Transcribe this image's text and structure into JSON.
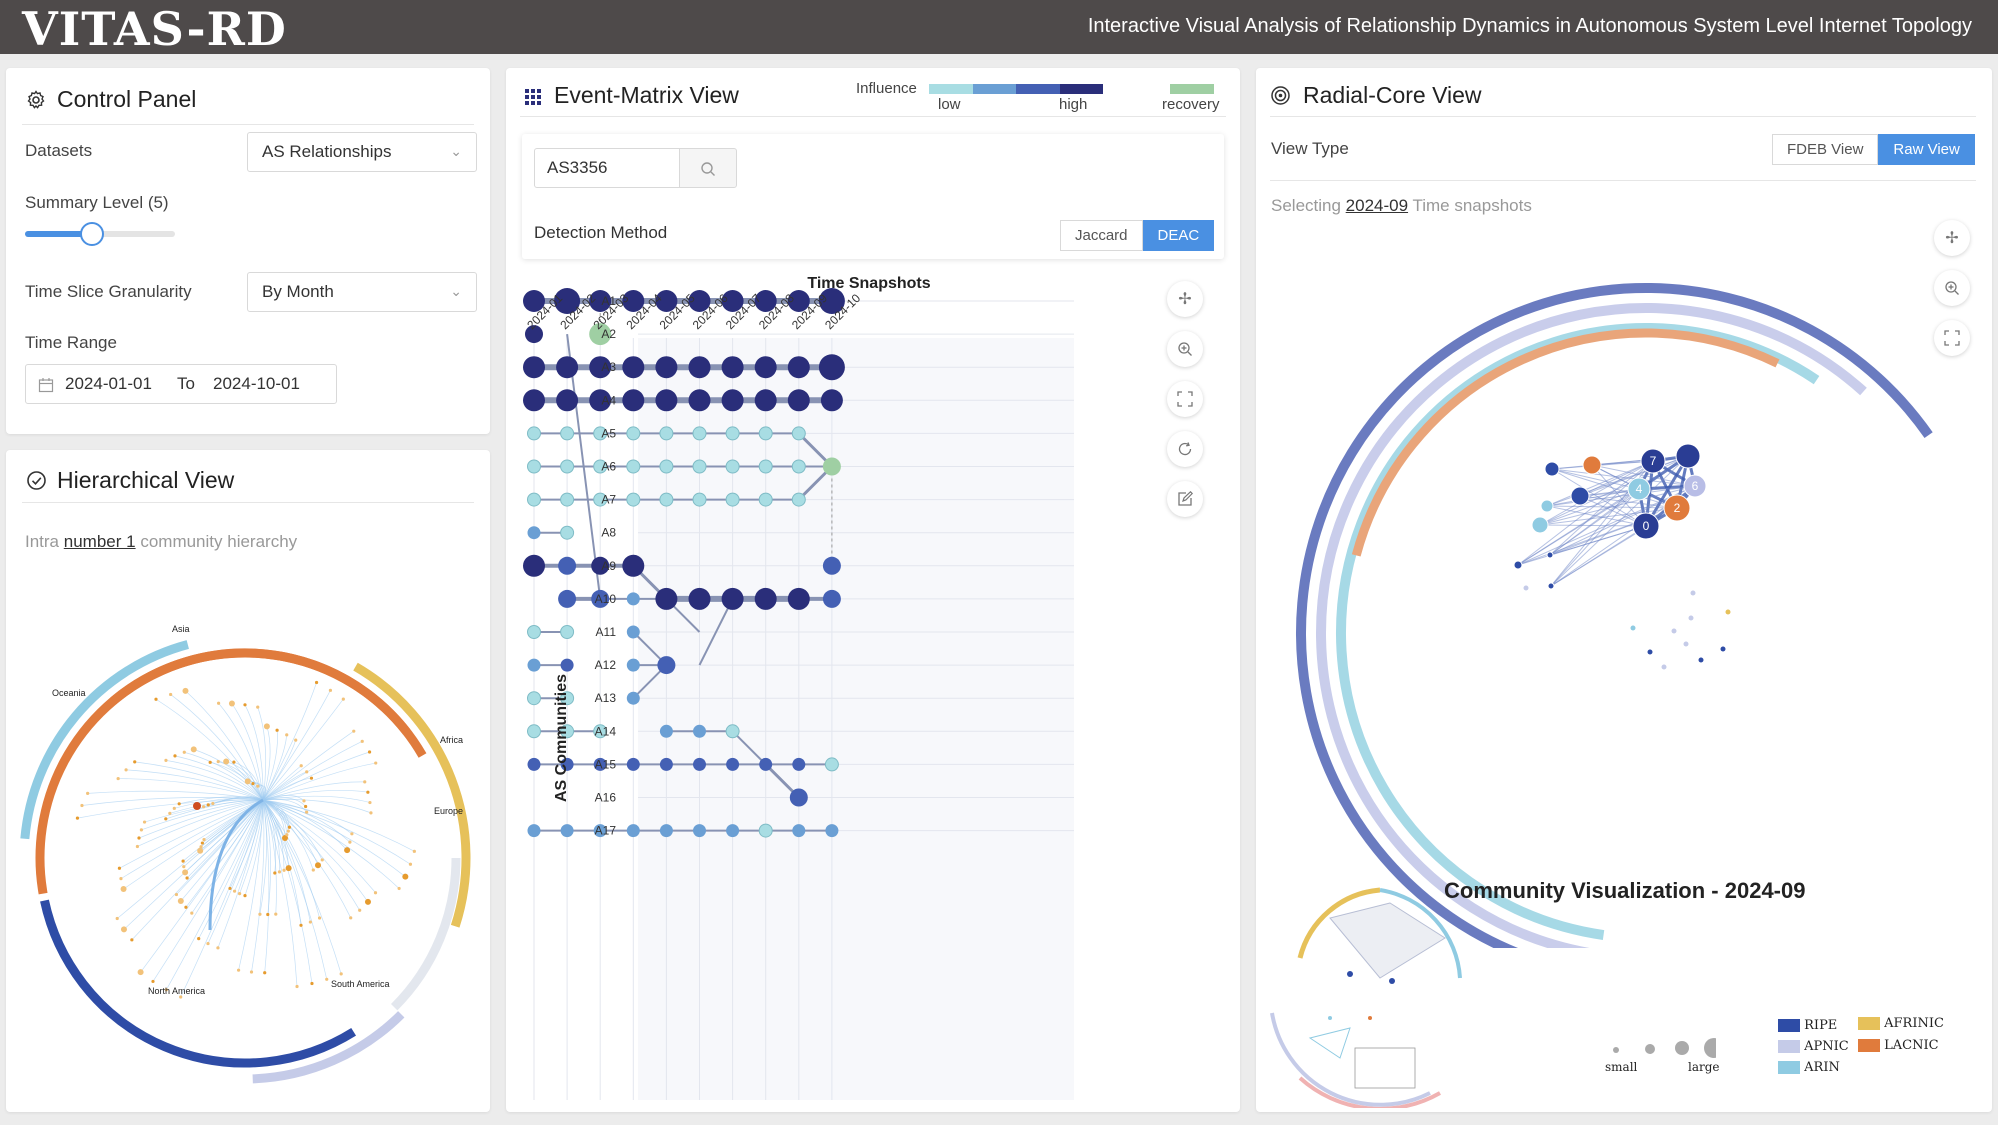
{
  "app": {
    "logo": "VITAS-RD",
    "subtitle": "Interactive Visual Analysis of Relationship Dynamics in Autonomous System Level Internet Topology"
  },
  "control_panel": {
    "title": "Control Panel",
    "datasets_label": "Datasets",
    "datasets_value": "AS Relationships",
    "summary_label": "Summary Level (5)",
    "summary_level": 5,
    "granularity_label": "Time Slice Granularity",
    "granularity_value": "By Month",
    "time_range_label": "Time Range",
    "time_from": "2024-01-01",
    "time_to_label": "To",
    "time_to": "2024-10-01"
  },
  "hierarchical": {
    "title": "Hierarchical View",
    "intra_prefix": "Intra",
    "intra_link": "number 1",
    "intra_suffix": "community hierarchy",
    "regions": [
      "Asia",
      "Oceania",
      "Africa",
      "Europe",
      "North America",
      "South America"
    ]
  },
  "event_matrix": {
    "title": "Event-Matrix View",
    "legend_influence": "Influence",
    "legend_low": "low",
    "legend_high": "high",
    "legend_recovery": "recovery",
    "search_value": "AS3356",
    "detection_label": "Detection Method",
    "method_options": [
      "Jaccard",
      "DEAC"
    ],
    "method_selected": "DEAC",
    "x_title": "Time Snapshots",
    "y_title": "AS Communities"
  },
  "chart_data": {
    "type": "scatter",
    "title": "Time Snapshots",
    "xlabel": "Time Snapshots",
    "ylabel": "AS Communities",
    "x": [
      "2024-01",
      "2024-02",
      "2024-03",
      "2024-04",
      "2024-05",
      "2024-06",
      "2024-07",
      "2024-08",
      "2024-09",
      "2024-10"
    ],
    "y": [
      "A1",
      "A2",
      "A3",
      "A4",
      "A5",
      "A6",
      "A7",
      "A8",
      "A9",
      "A10",
      "A11",
      "A12",
      "A13",
      "A14",
      "A15",
      "A16",
      "A17"
    ],
    "colors": {
      "low": "#a8dde3",
      "mid1": "#6a9fd4",
      "mid2": "#4460b4",
      "high": "#2a2e7a",
      "recovery": "#9fcfa3"
    },
    "points": [
      {
        "row": "A1",
        "cells": [
          [
            "2024-01",
            "high",
            3
          ],
          [
            "2024-02",
            "high",
            4
          ],
          [
            "2024-03",
            "high",
            3
          ],
          [
            "2024-04",
            "high",
            3
          ],
          [
            "2024-05",
            "high",
            3
          ],
          [
            "2024-06",
            "high",
            3
          ],
          [
            "2024-07",
            "high",
            3
          ],
          [
            "2024-08",
            "high",
            3
          ],
          [
            "2024-09",
            "high",
            3
          ],
          [
            "2024-10",
            "high",
            4
          ]
        ]
      },
      {
        "row": "A2",
        "cells": [
          [
            "2024-01",
            "high",
            2
          ],
          [
            "2024-03",
            "recovery",
            3
          ]
        ]
      },
      {
        "row": "A3",
        "cells": [
          [
            "2024-01",
            "high",
            3
          ],
          [
            "2024-02",
            "high",
            3
          ],
          [
            "2024-03",
            "high",
            3
          ],
          [
            "2024-04",
            "high",
            3
          ],
          [
            "2024-05",
            "high",
            3
          ],
          [
            "2024-06",
            "high",
            3
          ],
          [
            "2024-07",
            "high",
            3
          ],
          [
            "2024-08",
            "high",
            3
          ],
          [
            "2024-09",
            "high",
            3
          ],
          [
            "2024-10",
            "high",
            4
          ]
        ]
      },
      {
        "row": "A4",
        "cells": [
          [
            "2024-01",
            "high",
            3
          ],
          [
            "2024-02",
            "high",
            3
          ],
          [
            "2024-03",
            "high",
            3
          ],
          [
            "2024-04",
            "high",
            3
          ],
          [
            "2024-05",
            "high",
            3
          ],
          [
            "2024-06",
            "high",
            3
          ],
          [
            "2024-07",
            "high",
            3
          ],
          [
            "2024-08",
            "high",
            3
          ],
          [
            "2024-09",
            "high",
            3
          ],
          [
            "2024-10",
            "high",
            3
          ]
        ]
      },
      {
        "row": "A5",
        "cells": [
          [
            "2024-01",
            "low",
            1
          ],
          [
            "2024-02",
            "low",
            1
          ],
          [
            "2024-03",
            "low",
            1
          ],
          [
            "2024-04",
            "low",
            1
          ],
          [
            "2024-05",
            "low",
            1
          ],
          [
            "2024-06",
            "low",
            1
          ],
          [
            "2024-07",
            "low",
            1
          ],
          [
            "2024-08",
            "low",
            1
          ],
          [
            "2024-09",
            "low",
            1
          ]
        ]
      },
      {
        "row": "A6",
        "cells": [
          [
            "2024-01",
            "low",
            1
          ],
          [
            "2024-02",
            "low",
            1
          ],
          [
            "2024-03",
            "low",
            1
          ],
          [
            "2024-04",
            "low",
            1
          ],
          [
            "2024-05",
            "low",
            1
          ],
          [
            "2024-06",
            "low",
            1
          ],
          [
            "2024-07",
            "low",
            1
          ],
          [
            "2024-08",
            "low",
            1
          ],
          [
            "2024-09",
            "low",
            1
          ],
          [
            "2024-10",
            "recovery",
            2
          ]
        ]
      },
      {
        "row": "A7",
        "cells": [
          [
            "2024-01",
            "low",
            1
          ],
          [
            "2024-02",
            "low",
            1
          ],
          [
            "2024-03",
            "low",
            1
          ],
          [
            "2024-04",
            "low",
            1
          ],
          [
            "2024-05",
            "low",
            1
          ],
          [
            "2024-06",
            "low",
            1
          ],
          [
            "2024-07",
            "low",
            1
          ],
          [
            "2024-08",
            "low",
            1
          ],
          [
            "2024-09",
            "low",
            1
          ]
        ]
      },
      {
        "row": "A8",
        "cells": [
          [
            "2024-01",
            "mid1",
            1
          ],
          [
            "2024-02",
            "low",
            1
          ]
        ]
      },
      {
        "row": "A9",
        "cells": [
          [
            "2024-01",
            "high",
            3
          ],
          [
            "2024-02",
            "mid2",
            2
          ],
          [
            "2024-03",
            "high",
            2
          ],
          [
            "2024-04",
            "high",
            3
          ],
          [
            "2024-10",
            "mid2",
            2
          ]
        ]
      },
      {
        "row": "A10",
        "cells": [
          [
            "2024-02",
            "mid2",
            2
          ],
          [
            "2024-03",
            "mid2",
            2
          ],
          [
            "2024-04",
            "mid1",
            1
          ],
          [
            "2024-05",
            "high",
            3
          ],
          [
            "2024-06",
            "high",
            3
          ],
          [
            "2024-07",
            "high",
            3
          ],
          [
            "2024-08",
            "high",
            3
          ],
          [
            "2024-09",
            "high",
            3
          ],
          [
            "2024-10",
            "mid2",
            2
          ]
        ]
      },
      {
        "row": "A11",
        "cells": [
          [
            "2024-01",
            "low",
            1
          ],
          [
            "2024-02",
            "low",
            1
          ],
          [
            "2024-04",
            "mid1",
            1
          ]
        ]
      },
      {
        "row": "A12",
        "cells": [
          [
            "2024-01",
            "mid1",
            1
          ],
          [
            "2024-02",
            "mid2",
            1
          ],
          [
            "2024-04",
            "mid1",
            1
          ],
          [
            "2024-05",
            "mid2",
            2
          ]
        ]
      },
      {
        "row": "A13",
        "cells": [
          [
            "2024-01",
            "low",
            1
          ],
          [
            "2024-02",
            "low",
            1
          ],
          [
            "2024-04",
            "mid1",
            1
          ]
        ]
      },
      {
        "row": "A14",
        "cells": [
          [
            "2024-01",
            "low",
            1
          ],
          [
            "2024-02",
            "low",
            1
          ],
          [
            "2024-03",
            "low",
            1
          ],
          [
            "2024-05",
            "mid1",
            1
          ],
          [
            "2024-06",
            "mid1",
            1
          ],
          [
            "2024-07",
            "low",
            1
          ]
        ]
      },
      {
        "row": "A15",
        "cells": [
          [
            "2024-01",
            "mid2",
            1
          ],
          [
            "2024-02",
            "mid2",
            1
          ],
          [
            "2024-03",
            "mid2",
            1
          ],
          [
            "2024-04",
            "mid2",
            1
          ],
          [
            "2024-05",
            "mid2",
            1
          ],
          [
            "2024-06",
            "mid2",
            1
          ],
          [
            "2024-07",
            "mid2",
            1
          ],
          [
            "2024-08",
            "mid2",
            1
          ],
          [
            "2024-09",
            "mid2",
            1
          ],
          [
            "2024-10",
            "low",
            1
          ]
        ]
      },
      {
        "row": "A16",
        "cells": [
          [
            "2024-09",
            "mid2",
            2
          ]
        ]
      },
      {
        "row": "A17",
        "cells": [
          [
            "2024-01",
            "mid1",
            1
          ],
          [
            "2024-02",
            "mid1",
            1
          ],
          [
            "2024-03",
            "mid1",
            1
          ],
          [
            "2024-04",
            "mid1",
            1
          ],
          [
            "2024-05",
            "mid1",
            1
          ],
          [
            "2024-06",
            "mid1",
            1
          ],
          [
            "2024-07",
            "mid1",
            1
          ],
          [
            "2024-08",
            "low",
            1
          ],
          [
            "2024-09",
            "mid1",
            1
          ],
          [
            "2024-10",
            "mid1",
            1
          ]
        ]
      }
    ]
  },
  "radial": {
    "title": "Radial-Core View",
    "view_type_label": "View Type",
    "view_options": [
      "FDEB View",
      "Raw View"
    ],
    "view_selected": "Raw View",
    "selecting_prefix": "Selecting",
    "selecting_link": "2024-09",
    "selecting_suffix": "Time snapshots",
    "node_labels": [
      "7",
      "6",
      "4",
      "2",
      "0"
    ],
    "community_title": "Community Visualization - 2024-09",
    "size_small": "small",
    "size_large": "large",
    "legend": [
      {
        "name": "RIPE",
        "color": "#2e4ca6"
      },
      {
        "name": "AFRINIC",
        "color": "#e6c15a"
      },
      {
        "name": "APNIC",
        "color": "#c5cbe8"
      },
      {
        "name": "LACNIC",
        "color": "#e07b3c"
      },
      {
        "name": "ARIN",
        "color": "#8fcbe2"
      }
    ]
  },
  "icons": [
    "gear-icon",
    "grid-icon",
    "target-icon",
    "check-circle-icon",
    "search-icon",
    "calendar-icon",
    "move-icon",
    "zoom-in-icon",
    "fullscreen-icon",
    "refresh-icon",
    "edit-icon"
  ]
}
